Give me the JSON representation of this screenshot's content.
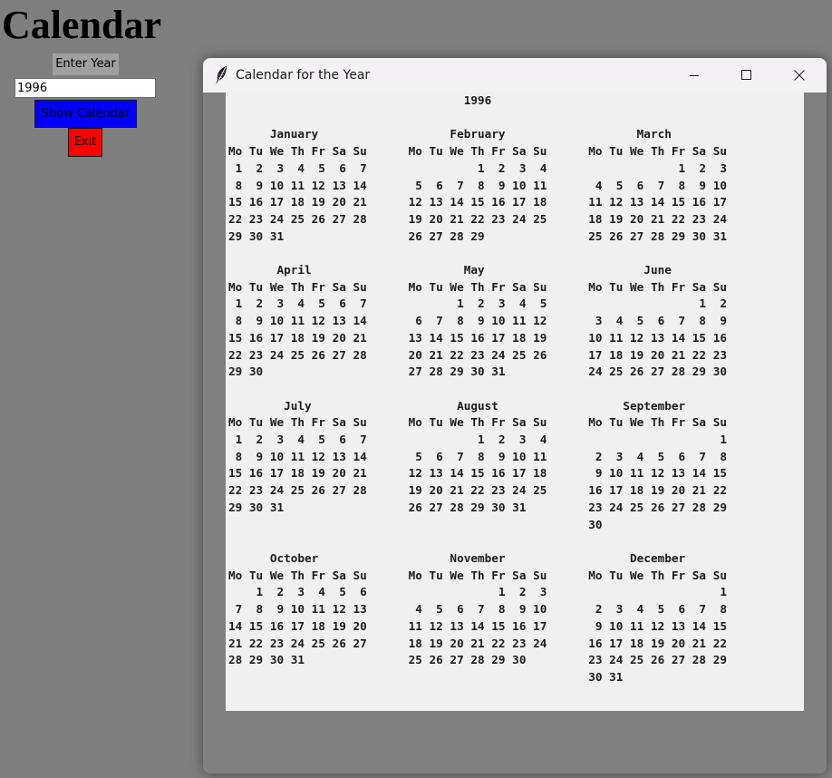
{
  "app": {
    "title": "Calendar",
    "year_label": "Enter Year",
    "year_input_value": "1996",
    "show_button_label": "Show Calendar",
    "exit_button_label": "Exit"
  },
  "calendar_window": {
    "title": "Calendar for the Year",
    "icon": "feather-icon",
    "controls": [
      "minimize-icon",
      "maximize-icon",
      "close-icon"
    ],
    "year": "1996",
    "calendar_text": "                                  1996\n\n      January                   February                   March\nMo Tu We Th Fr Sa Su      Mo Tu We Th Fr Sa Su      Mo Tu We Th Fr Sa Su\n 1  2  3  4  5  6  7                1  2  3  4                   1  2  3\n 8  9 10 11 12 13 14       5  6  7  8  9 10 11       4  5  6  7  8  9 10\n15 16 17 18 19 20 21      12 13 14 15 16 17 18      11 12 13 14 15 16 17\n22 23 24 25 26 27 28      19 20 21 22 23 24 25      18 19 20 21 22 23 24\n29 30 31                  26 27 28 29               25 26 27 28 29 30 31\n\n       April                      May                       June\nMo Tu We Th Fr Sa Su      Mo Tu We Th Fr Sa Su      Mo Tu We Th Fr Sa Su\n 1  2  3  4  5  6  7             1  2  3  4  5                      1  2\n 8  9 10 11 12 13 14       6  7  8  9 10 11 12       3  4  5  6  7  8  9\n15 16 17 18 19 20 21      13 14 15 16 17 18 19      10 11 12 13 14 15 16\n22 23 24 25 26 27 28      20 21 22 23 24 25 26      17 18 19 20 21 22 23\n29 30                     27 28 29 30 31            24 25 26 27 28 29 30\n\n        July                     August                  September\nMo Tu We Th Fr Sa Su      Mo Tu We Th Fr Sa Su      Mo Tu We Th Fr Sa Su\n 1  2  3  4  5  6  7                1  2  3  4                         1\n 8  9 10 11 12 13 14       5  6  7  8  9 10 11       2  3  4  5  6  7  8\n15 16 17 18 19 20 21      12 13 14 15 16 17 18       9 10 11 12 13 14 15\n22 23 24 25 26 27 28      19 20 21 22 23 24 25      16 17 18 19 20 21 22\n29 30 31                  26 27 28 29 30 31         23 24 25 26 27 28 29\n                                                    30\n\n      October                   November                  December\nMo Tu We Th Fr Sa Su      Mo Tu We Th Fr Sa Su      Mo Tu We Th Fr Sa Su\n    1  2  3  4  5  6                   1  2  3                         1\n 7  8  9 10 11 12 13       4  5  6  7  8  9 10       2  3  4  5  6  7  8\n14 15 16 17 18 19 20      11 12 13 14 15 16 17       9 10 11 12 13 14 15\n21 22 23 24 25 26 27      18 19 20 21 22 23 24      16 17 18 19 20 21 22\n28 29 30 31               25 26 27 28 29 30         23 24 25 26 27 28 29\n                                                    30 31"
  },
  "colors": {
    "background": "#7f7f7f",
    "show_button": "#0000ff",
    "exit_button": "#ff0000",
    "label_background": "#a0a0a0",
    "calendar_background": "#f0f0f0"
  }
}
